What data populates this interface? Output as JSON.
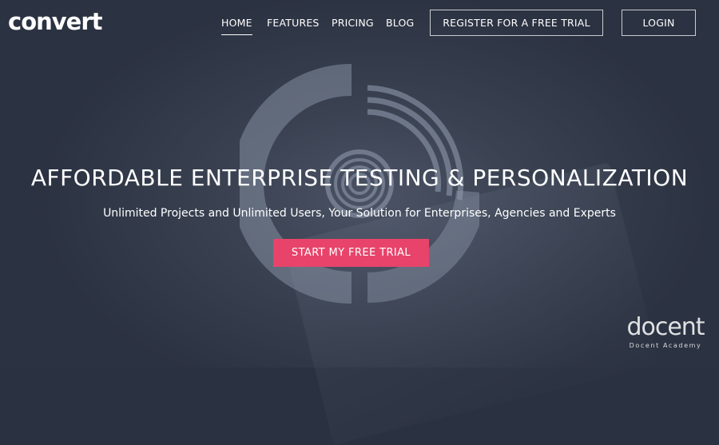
{
  "header": {
    "logo_text": "convert",
    "nav": [
      {
        "label": "HOME",
        "active": true
      },
      {
        "label": "FEATURES",
        "active": false
      },
      {
        "label": "PRICING",
        "active": false
      },
      {
        "label": "BLOG",
        "active": false
      }
    ],
    "register_label": "REGISTER FOR A FREE TRIAL",
    "login_label": "LOGIN"
  },
  "hero": {
    "title": "AFFORDABLE ENTERPRISE TESTING & PERSONALIZATION",
    "subtitle": "Unlimited Projects and Unlimited Users, Your Solution for Enterprises, Agencies and Experts",
    "cta_label": "START MY FREE TRIAL"
  },
  "watermark": {
    "mark": "docent",
    "caption": "Docent Academy"
  },
  "colors": {
    "background": "#2a3140",
    "accent": "#e8436a",
    "text": "#ffffff"
  },
  "icons": [
    "convert-logo",
    "circular-emblem-graphic",
    "docent-academy-logo"
  ]
}
